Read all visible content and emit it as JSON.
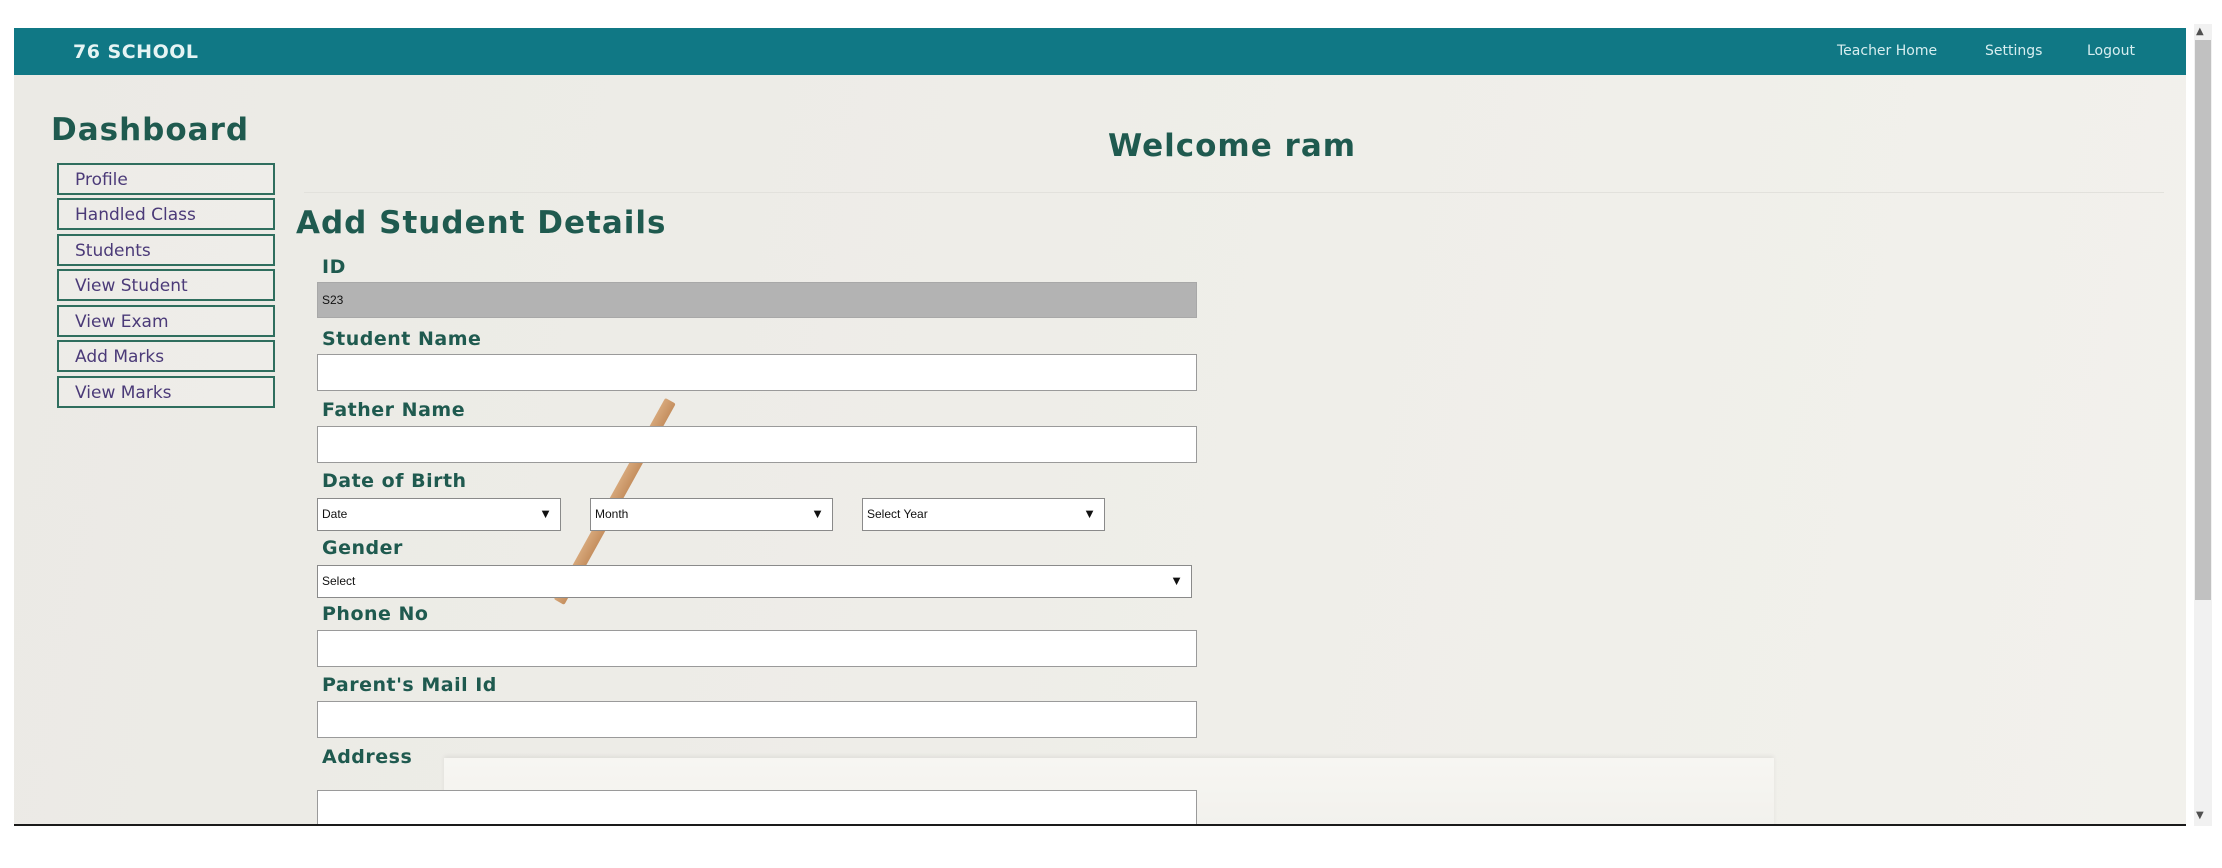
{
  "navbar": {
    "brand": "76 SCHOOL",
    "links": [
      "Teacher Home",
      "Settings",
      "Logout"
    ],
    "color": "#107885"
  },
  "sidebar": {
    "title": "Dashboard",
    "items": [
      "Profile",
      "Handled Class",
      "Students",
      "View Student",
      "View Exam",
      "Add Marks",
      "View Marks"
    ]
  },
  "main": {
    "welcome": "Welcome ram",
    "form_title": "Add Student Details",
    "fields": {
      "id": {
        "label": "ID",
        "value": "S23"
      },
      "student_name": {
        "label": "Student Name",
        "value": ""
      },
      "father_name": {
        "label": "Father Name",
        "value": ""
      },
      "dob": {
        "label": "Date of Birth",
        "date": "Date",
        "month": "Month",
        "year": "Select Year"
      },
      "gender": {
        "label": "Gender",
        "selected": "Select"
      },
      "phone": {
        "label": "Phone No",
        "value": ""
      },
      "parent_mail": {
        "label": "Parent's Mail Id",
        "value": ""
      },
      "address": {
        "label": "Address",
        "value": ""
      }
    }
  },
  "icons": {
    "dropdown": "▼",
    "scroll_up": "▲",
    "scroll_down": "▼"
  }
}
